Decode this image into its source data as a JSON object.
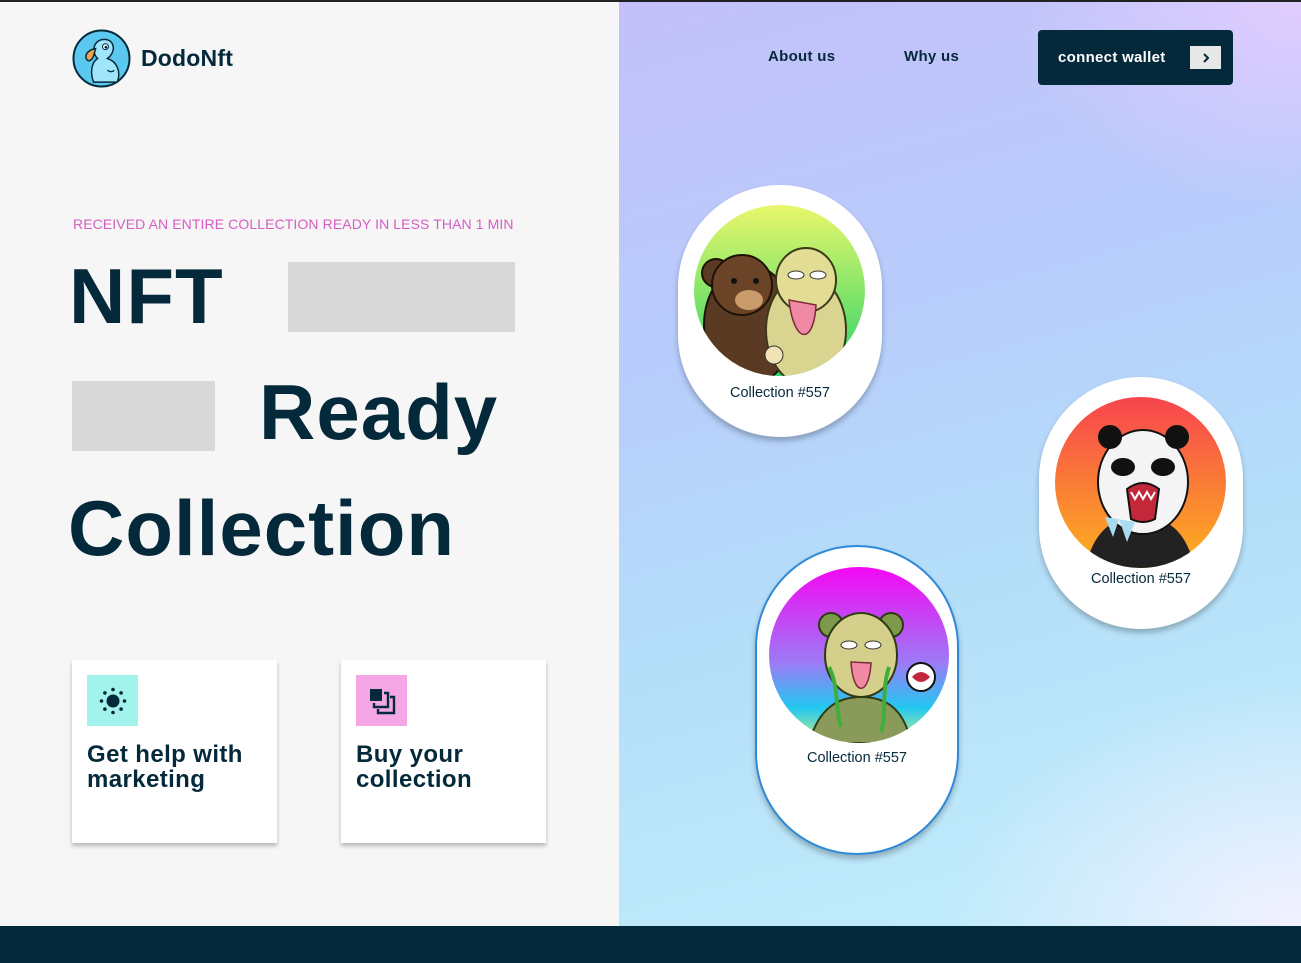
{
  "brand": {
    "name": "DodoNft",
    "logo_icon": "dodo-bird-icon"
  },
  "nav": {
    "about": "About us",
    "why": "Why us",
    "wallet_button": "connect wallet",
    "wallet_arrow_icon": "chevron-right-icon"
  },
  "hero": {
    "eyebrow": "RECEIVED AN ENTIRE COLLECTION READY IN LESS THAN 1 MIN",
    "line1": "NFT",
    "line2": "Ready",
    "line3": "Collection"
  },
  "features": [
    {
      "title_line1": "Get help with",
      "title_line2": "marketing",
      "icon": "sun-icon",
      "icon_color": "#a1f3eb"
    },
    {
      "title_line1": "Buy your",
      "title_line2": "collection",
      "icon": "stacked-squares-icon",
      "icon_color": "#f4a7e4"
    }
  ],
  "collections": [
    {
      "label": "Collection #557",
      "art": "bear-zombie-art"
    },
    {
      "label": "Collection #557",
      "art": "panda-zombie-art"
    },
    {
      "label": "Collection #557",
      "art": "vine-bear-zombie-art"
    }
  ],
  "colors": {
    "primary": "#04293a",
    "accent_pink": "#d65dc3",
    "placeholder": "#d9d9d9",
    "highlight_border": "#2d8ad8"
  }
}
